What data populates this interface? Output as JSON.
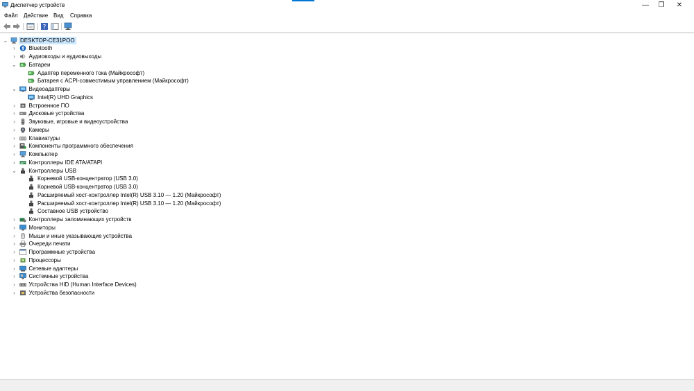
{
  "window": {
    "title": "Диспетчер устройств",
    "accent_color": "#0078d7",
    "min_glyph": "—",
    "max_glyph": "❐",
    "close_glyph": "✕"
  },
  "menu": [
    "Файл",
    "Действие",
    "Вид",
    "Справка"
  ],
  "toolbar": {
    "buttons": [
      "back-icon",
      "forward-icon",
      "properties-icon",
      "help-icon",
      "view-icon",
      "monitor-icon"
    ]
  },
  "tree": {
    "root": "DESKTOP-CE31POO",
    "items": [
      {
        "label": "Bluetooth",
        "expanded": false,
        "icon": "bluetooth-icon"
      },
      {
        "label": "Аудиовходы и аудиовыходы",
        "expanded": false,
        "icon": "audio-icon"
      },
      {
        "label": "Батареи",
        "expanded": true,
        "icon": "battery-icon",
        "children": [
          {
            "label": "Адаптер переменного тока (Майкрософт)",
            "icon": "battery-icon"
          },
          {
            "label": "Батарея с ACPI-совместимым управлением (Майкрософт)",
            "icon": "battery-icon"
          }
        ]
      },
      {
        "label": "Видеоадаптеры",
        "expanded": true,
        "icon": "display-adapter-icon",
        "children": [
          {
            "label": "Intel(R) UHD Graphics",
            "icon": "display-adapter-icon"
          }
        ]
      },
      {
        "label": "Встроенное ПО",
        "expanded": false,
        "icon": "firmware-icon"
      },
      {
        "label": "Дисковые устройства",
        "expanded": false,
        "icon": "disk-icon"
      },
      {
        "label": "Звуковые, игровые и видеоустройства",
        "expanded": false,
        "icon": "sound-icon"
      },
      {
        "label": "Камеры",
        "expanded": false,
        "icon": "camera-icon"
      },
      {
        "label": "Клавиатуры",
        "expanded": false,
        "icon": "keyboard-icon"
      },
      {
        "label": "Компоненты программного обеспечения",
        "expanded": false,
        "icon": "software-component-icon"
      },
      {
        "label": "Компьютер",
        "expanded": false,
        "icon": "computer-icon"
      },
      {
        "label": "Контроллеры IDE ATA/ATAPI",
        "expanded": false,
        "icon": "ide-controller-icon"
      },
      {
        "label": "Контроллеры USB",
        "expanded": true,
        "icon": "usb-icon",
        "children": [
          {
            "label": "Корневой USB-концентратор (USB 3.0)",
            "icon": "usb-icon"
          },
          {
            "label": "Корневой USB-концентратор (USB 3.0)",
            "icon": "usb-icon"
          },
          {
            "label": "Расширяемый хост-контроллер Intel(R) USB 3.10 — 1.20 (Майкрософт)",
            "icon": "usb-icon"
          },
          {
            "label": "Расширяемый хост-контроллер Intel(R) USB 3.10 — 1.20 (Майкрософт)",
            "icon": "usb-icon"
          },
          {
            "label": "Составное USB устройство",
            "icon": "usb-icon"
          }
        ]
      },
      {
        "label": "Контроллеры запоминающих устройств",
        "expanded": false,
        "icon": "storage-controller-icon"
      },
      {
        "label": "Мониторы",
        "expanded": false,
        "icon": "monitor-icon"
      },
      {
        "label": "Мыши и иные указывающие устройства",
        "expanded": false,
        "icon": "mouse-icon"
      },
      {
        "label": "Очереди печати",
        "expanded": false,
        "icon": "printer-icon"
      },
      {
        "label": "Программные устройства",
        "expanded": false,
        "icon": "software-device-icon"
      },
      {
        "label": "Процессоры",
        "expanded": false,
        "icon": "processor-icon"
      },
      {
        "label": "Сетевые адаптеры",
        "expanded": false,
        "icon": "network-adapter-icon"
      },
      {
        "label": "Системные устройства",
        "expanded": false,
        "icon": "system-device-icon"
      },
      {
        "label": "Устройства HID (Human Interface Devices)",
        "expanded": false,
        "icon": "hid-icon"
      },
      {
        "label": "Устройства безопасности",
        "expanded": false,
        "icon": "security-device-icon"
      }
    ]
  }
}
